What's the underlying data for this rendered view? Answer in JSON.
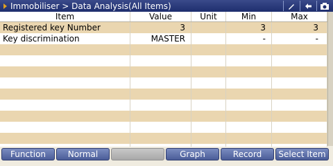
{
  "title": {
    "breadcrumb": "Immobiliser > Data Analysis(All Items)",
    "icons": [
      "pen-icon",
      "back-arrow-icon",
      "camera-icon"
    ]
  },
  "table": {
    "columns": [
      "Item",
      "Value",
      "Unit",
      "Min",
      "Max"
    ],
    "rows": [
      {
        "item": "Registered key Number",
        "value": "3",
        "unit": "",
        "min": "3",
        "max": "3"
      },
      {
        "item": "Key discrimination",
        "value": "MASTER",
        "unit": "",
        "min": "-",
        "max": "-"
      }
    ]
  },
  "footer": {
    "buttons": [
      "Function",
      "Normal",
      "",
      "Graph",
      "Record",
      "Select Item"
    ]
  },
  "colors": {
    "titlebar": "#1e2e6e",
    "row_stripe": "#ead6b0",
    "button": "#4a5c98"
  }
}
